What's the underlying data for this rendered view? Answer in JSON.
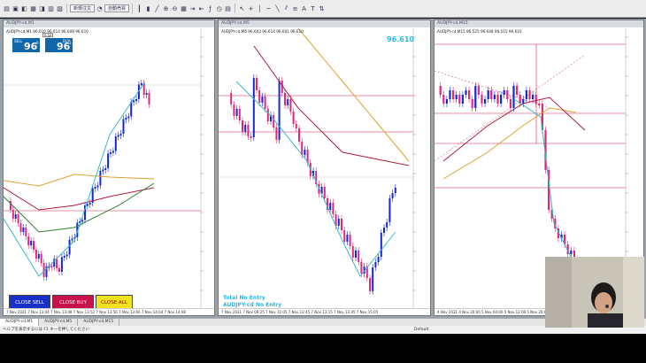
{
  "toolbar": {
    "orders_label": "新規注文",
    "auto_trade_label": "自動売買"
  },
  "chart1": {
    "title": "AUDJPY-cd,M1",
    "info": "AUDJPY-cd,M1  96.610 96.614 96.608 96.610",
    "sell_label": "SELL",
    "buy_label": "BUY",
    "sell_price": "96 61",
    "sell_sup": "0",
    "buy_price": "96 61",
    "buy_sup": "3",
    "lot": "0.40",
    "close_sell": "CLOSE SELL",
    "close_buy": "CLOSE BUY",
    "close_all": "CLOSE ALL",
    "xaxis": [
      "7 Nov 2021",
      "7 Nov 13:44",
      "7 Nov 13:48",
      "7 Nov 13:52",
      "7 Nov 13:56",
      "7 Nov 13:60",
      "7 Nov 14:04",
      "7 Nov 14:08"
    ]
  },
  "chart2": {
    "title": "AUDJPY-cd,M5",
    "info": "AUDJPY-cd,M5  96.603 96.614 96.601 96.610",
    "price": "96.610",
    "entry1": "Total No Entry",
    "entry2": "AUDJPY-cd No Entry",
    "xaxis": [
      "7 Nov 2021",
      "7 Nov 09:25",
      "7 Nov 11:05",
      "7 Nov 12:45",
      "7 Nov 13:15",
      "7 Nov 13:45",
      "7 Nov 15:05"
    ]
  },
  "chart3": {
    "title": "AUDJPY-cd,M15",
    "info": "AUDJPY-cd,M15  96.525 96.648 96.515 96.610",
    "xaxis": [
      "4 Nov 2021",
      "4 Nov 20:00",
      "5 Nov 04:00",
      "5 Nov 12:00",
      "5 Nov 20:00",
      "6 Nov 04:00",
      "7 Nov"
    ]
  },
  "tabs": [
    "AUDJPY-cd,M1",
    "AUDJPY-cd,M5",
    "AUDJPY-cd,M15"
  ],
  "status": {
    "left": "ヘルプを表示するには F1 キーを押してください",
    "middle": "Default"
  },
  "colors": {
    "bull": "#1428d8",
    "bear": "#e0287a",
    "ma_fast": "#36b8c8",
    "ma_mid": "#b01c3c",
    "ma_slow": "#e0a030",
    "ma_green": "#2a8030",
    "hline": "#d62050",
    "bigprice": "#2ab7e8"
  }
}
